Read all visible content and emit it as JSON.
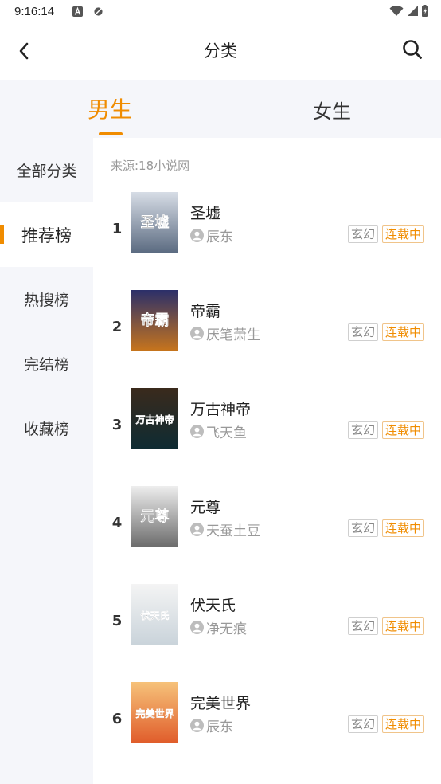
{
  "status": {
    "time": "9:16:14"
  },
  "header": {
    "title": "分类"
  },
  "gender_tabs": [
    {
      "label": "男生",
      "active": true
    },
    {
      "label": "女生",
      "active": false
    }
  ],
  "sidebar": {
    "items": [
      {
        "label": "全部分类",
        "active": false
      },
      {
        "label": "推荐榜",
        "active": true
      },
      {
        "label": "热搜榜",
        "active": false
      },
      {
        "label": "完结榜",
        "active": false
      },
      {
        "label": "收藏榜",
        "active": false
      }
    ]
  },
  "list": {
    "source": "来源:18小说网",
    "books": [
      {
        "rank": "1",
        "title": "圣墟",
        "author": "辰东",
        "genre": "玄幻",
        "status": "连载中",
        "cover_text": "圣墟",
        "cover_colors": [
          "#d7dde6",
          "#5a6a80"
        ]
      },
      {
        "rank": "2",
        "title": "帝霸",
        "author": "厌笔萧生",
        "genre": "玄幻",
        "status": "连载中",
        "cover_text": "帝霸",
        "cover_colors": [
          "#2b2f6a",
          "#c8751c"
        ]
      },
      {
        "rank": "3",
        "title": "万古神帝",
        "author": "飞天鱼",
        "genre": "玄幻",
        "status": "连载中",
        "cover_text": "万古神帝",
        "cover_colors": [
          "#3a2a1c",
          "#0e2b33"
        ]
      },
      {
        "rank": "4",
        "title": "元尊",
        "author": "天蚕土豆",
        "genre": "玄幻",
        "status": "连载中",
        "cover_text": "元尊",
        "cover_colors": [
          "#eeeeee",
          "#6b6b6b"
        ]
      },
      {
        "rank": "5",
        "title": "伏天氏",
        "author": "净无痕",
        "genre": "玄幻",
        "status": "连载中",
        "cover_text": "伏天氏",
        "cover_colors": [
          "#f4f4f4",
          "#c9d3da"
        ]
      },
      {
        "rank": "6",
        "title": "完美世界",
        "author": "辰东",
        "genre": "玄幻",
        "status": "连载中",
        "cover_text": "完美世界",
        "cover_colors": [
          "#f6c27a",
          "#e05c2a"
        ]
      }
    ]
  },
  "colors": {
    "accent": "#f08c00",
    "sidebar_bg": "#f5f6fa"
  }
}
